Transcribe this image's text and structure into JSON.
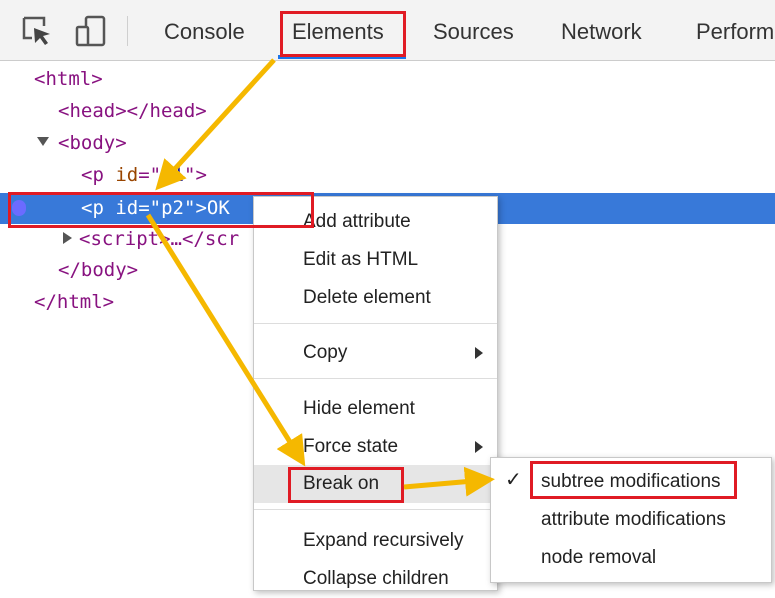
{
  "toolbar": {
    "icons": [
      "inspect-element-icon",
      "device-toolbar-icon"
    ],
    "tabs": [
      "Console",
      "Elements",
      "Sources",
      "Network",
      "Perform"
    ],
    "active_tab": "Elements"
  },
  "dom": {
    "html_open": "<html>",
    "head": "<head></head>",
    "body_open": "<body>",
    "p1": {
      "open": "<p ",
      "attr": "id",
      "eq": "=\"",
      "val": "p1",
      "close": "\">"
    },
    "p2": {
      "open": "<p ",
      "attr": "id",
      "eq": "=\"",
      "val": "p2",
      "close": "\">",
      "text": "OK"
    },
    "script": "<script>…</scr",
    "body_close": "</body>",
    "html_close": "</html>"
  },
  "context_menu": {
    "items": [
      "Add attribute",
      "Edit as HTML",
      "Delete element",
      "Copy",
      "Hide element",
      "Force state",
      "Break on",
      "Expand recursively",
      "Collapse children"
    ]
  },
  "break_on_submenu": {
    "checked": "✓",
    "items": [
      "subtree modifications",
      "attribute modifications",
      "node removal"
    ]
  },
  "colors": {
    "selection": "#3879d9",
    "highlight_box": "#e01b24",
    "arrow": "#f5b800",
    "tag": "#881280"
  }
}
